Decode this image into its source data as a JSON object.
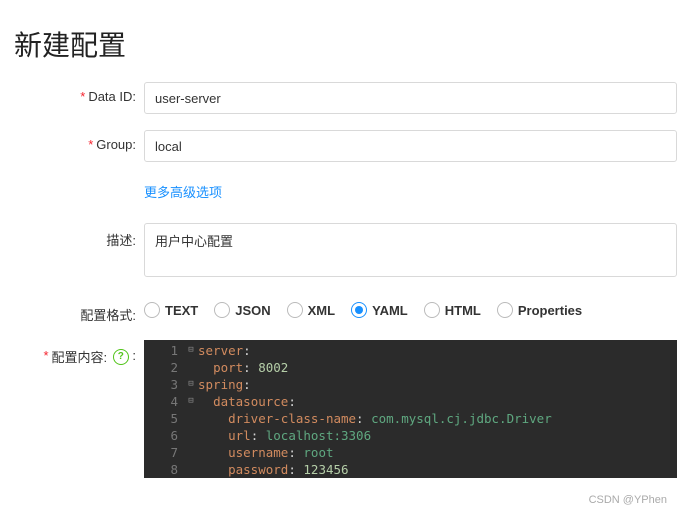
{
  "title": "新建配置",
  "labels": {
    "dataId": "Data ID:",
    "group": "Group:",
    "desc": "描述:",
    "format": "配置格式:",
    "content": "配置内容:"
  },
  "values": {
    "dataId": "user-server",
    "group": "local",
    "desc": "用户中心配置"
  },
  "advLink": "更多高级选项",
  "formats": {
    "options": [
      "TEXT",
      "JSON",
      "XML",
      "YAML",
      "HTML",
      "Properties"
    ],
    "selected": "YAML"
  },
  "code": [
    {
      "n": 1,
      "fold": "⊟",
      "indent": 0,
      "key": "server",
      "val": null,
      "type": "none"
    },
    {
      "n": 2,
      "fold": "",
      "indent": 1,
      "key": "port",
      "val": "8002",
      "type": "num"
    },
    {
      "n": 3,
      "fold": "⊟",
      "indent": 0,
      "key": "spring",
      "val": null,
      "type": "none"
    },
    {
      "n": 4,
      "fold": "⊟",
      "indent": 1,
      "key": "datasource",
      "val": null,
      "type": "none"
    },
    {
      "n": 5,
      "fold": "",
      "indent": 2,
      "key": "driver-class-name",
      "val": "com.mysql.cj.jdbc.Driver",
      "type": "str"
    },
    {
      "n": 6,
      "fold": "",
      "indent": 2,
      "key": "url",
      "val": "localhost:3306",
      "type": "str"
    },
    {
      "n": 7,
      "fold": "",
      "indent": 2,
      "key": "username",
      "val": "root",
      "type": "str"
    },
    {
      "n": 8,
      "fold": "",
      "indent": 2,
      "key": "password",
      "val": "123456",
      "type": "num"
    }
  ],
  "watermark": "CSDN @YPhen"
}
